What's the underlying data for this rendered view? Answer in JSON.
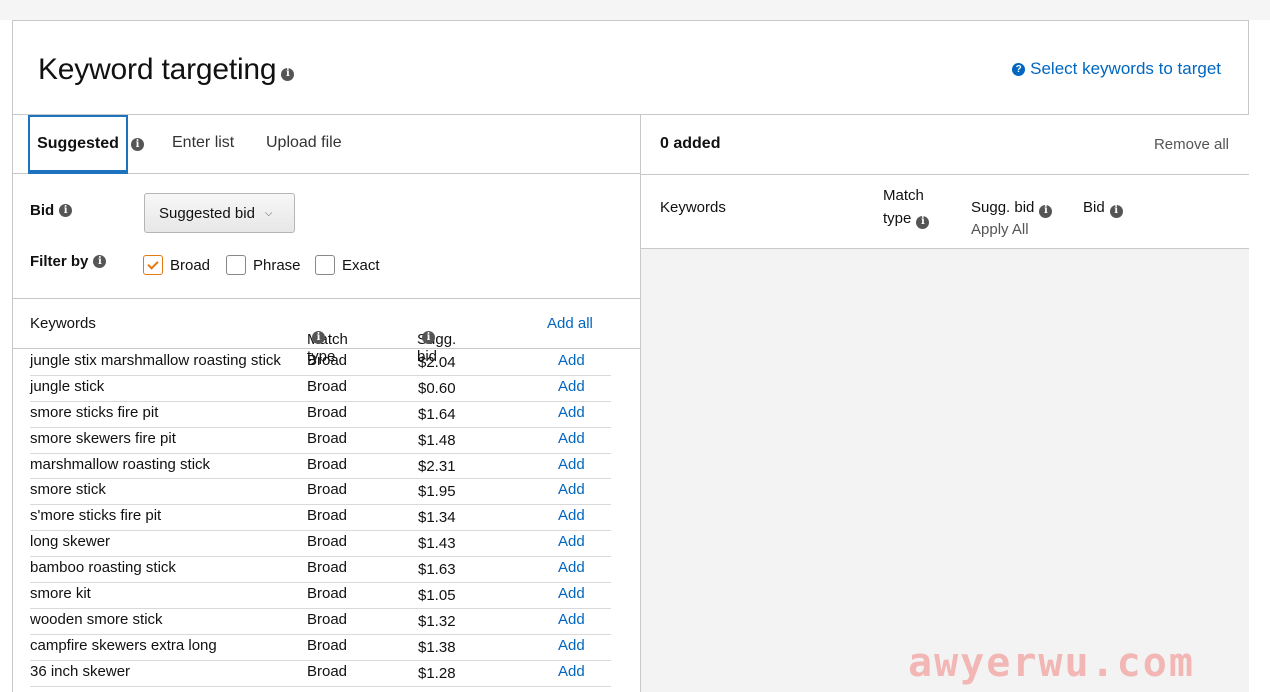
{
  "header": {
    "title": "Keyword targeting",
    "select_link": "Select keywords to target"
  },
  "tabs": {
    "suggested": "Suggested",
    "enter_list": "Enter list",
    "upload_file": "Upload file"
  },
  "bid": {
    "label": "Bid",
    "selected": "Suggested bid"
  },
  "filter": {
    "label": "Filter by",
    "options": [
      {
        "label": "Broad",
        "checked": true
      },
      {
        "label": "Phrase",
        "checked": false
      },
      {
        "label": "Exact",
        "checked": false
      }
    ]
  },
  "table": {
    "headers": {
      "keywords": "Keywords",
      "match_type": "Match type",
      "sugg_bid": "Sugg. bid",
      "add_all": "Add all"
    },
    "rows": [
      {
        "keyword": "jungle stix marshmallow roasting stick",
        "match": "Broad",
        "bid": "$2.04",
        "action": "Add"
      },
      {
        "keyword": "jungle stick",
        "match": "Broad",
        "bid": "$0.60",
        "action": "Add"
      },
      {
        "keyword": "smore sticks fire pit",
        "match": "Broad",
        "bid": "$1.64",
        "action": "Add"
      },
      {
        "keyword": "smore skewers fire pit",
        "match": "Broad",
        "bid": "$1.48",
        "action": "Add"
      },
      {
        "keyword": "marshmallow roasting stick",
        "match": "Broad",
        "bid": "$2.31",
        "action": "Add"
      },
      {
        "keyword": "smore stick",
        "match": "Broad",
        "bid": "$1.95",
        "action": "Add"
      },
      {
        "keyword": "s'more sticks fire pit",
        "match": "Broad",
        "bid": "$1.34",
        "action": "Add"
      },
      {
        "keyword": "long skewer",
        "match": "Broad",
        "bid": "$1.43",
        "action": "Add"
      },
      {
        "keyword": "bamboo roasting stick",
        "match": "Broad",
        "bid": "$1.63",
        "action": "Add"
      },
      {
        "keyword": "smore kit",
        "match": "Broad",
        "bid": "$1.05",
        "action": "Add"
      },
      {
        "keyword": "wooden smore stick",
        "match": "Broad",
        "bid": "$1.32",
        "action": "Add"
      },
      {
        "keyword": "campfire skewers extra long",
        "match": "Broad",
        "bid": "$1.38",
        "action": "Add"
      },
      {
        "keyword": "36 inch skewer",
        "match": "Broad",
        "bid": "$1.28",
        "action": "Add"
      }
    ]
  },
  "added": {
    "count_label": "0 added",
    "remove_all": "Remove all",
    "headers": {
      "keywords": "Keywords",
      "match": "Match",
      "type": "type",
      "sugg_bid": "Sugg. bid",
      "apply_all": "Apply All",
      "bid": "Bid"
    }
  },
  "watermark": "awyerwu.com",
  "colors": {
    "link": "#0066c0",
    "tab_accent": "#1e73be",
    "checkbox_accent": "#e47911"
  }
}
